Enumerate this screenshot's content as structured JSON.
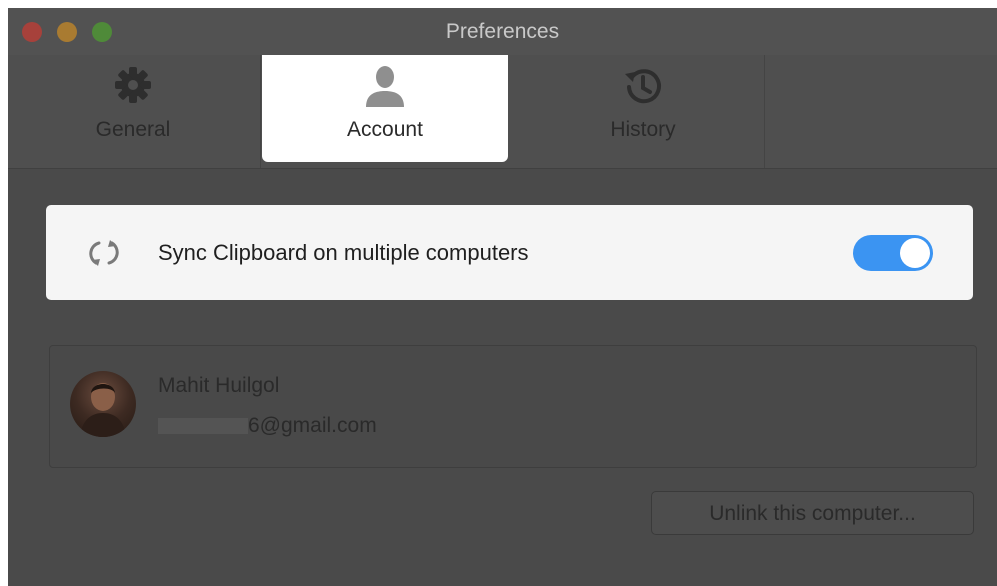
{
  "window": {
    "title": "Preferences"
  },
  "tabs": [
    {
      "label": "General",
      "icon": "gear-icon"
    },
    {
      "label": "Account",
      "icon": "user-icon",
      "selected": true
    },
    {
      "label": "History",
      "icon": "history-icon"
    }
  ],
  "sync": {
    "label": "Sync Clipboard on multiple computers",
    "enabled": true,
    "icon": "sync-icon"
  },
  "account": {
    "name": "Mahit Huilgol",
    "email_visible": "6@gmail.com"
  },
  "actions": {
    "unlink_label": "Unlink this computer..."
  },
  "colors": {
    "toggle_on": "#3b94f2",
    "background": "#4a4a4a"
  }
}
